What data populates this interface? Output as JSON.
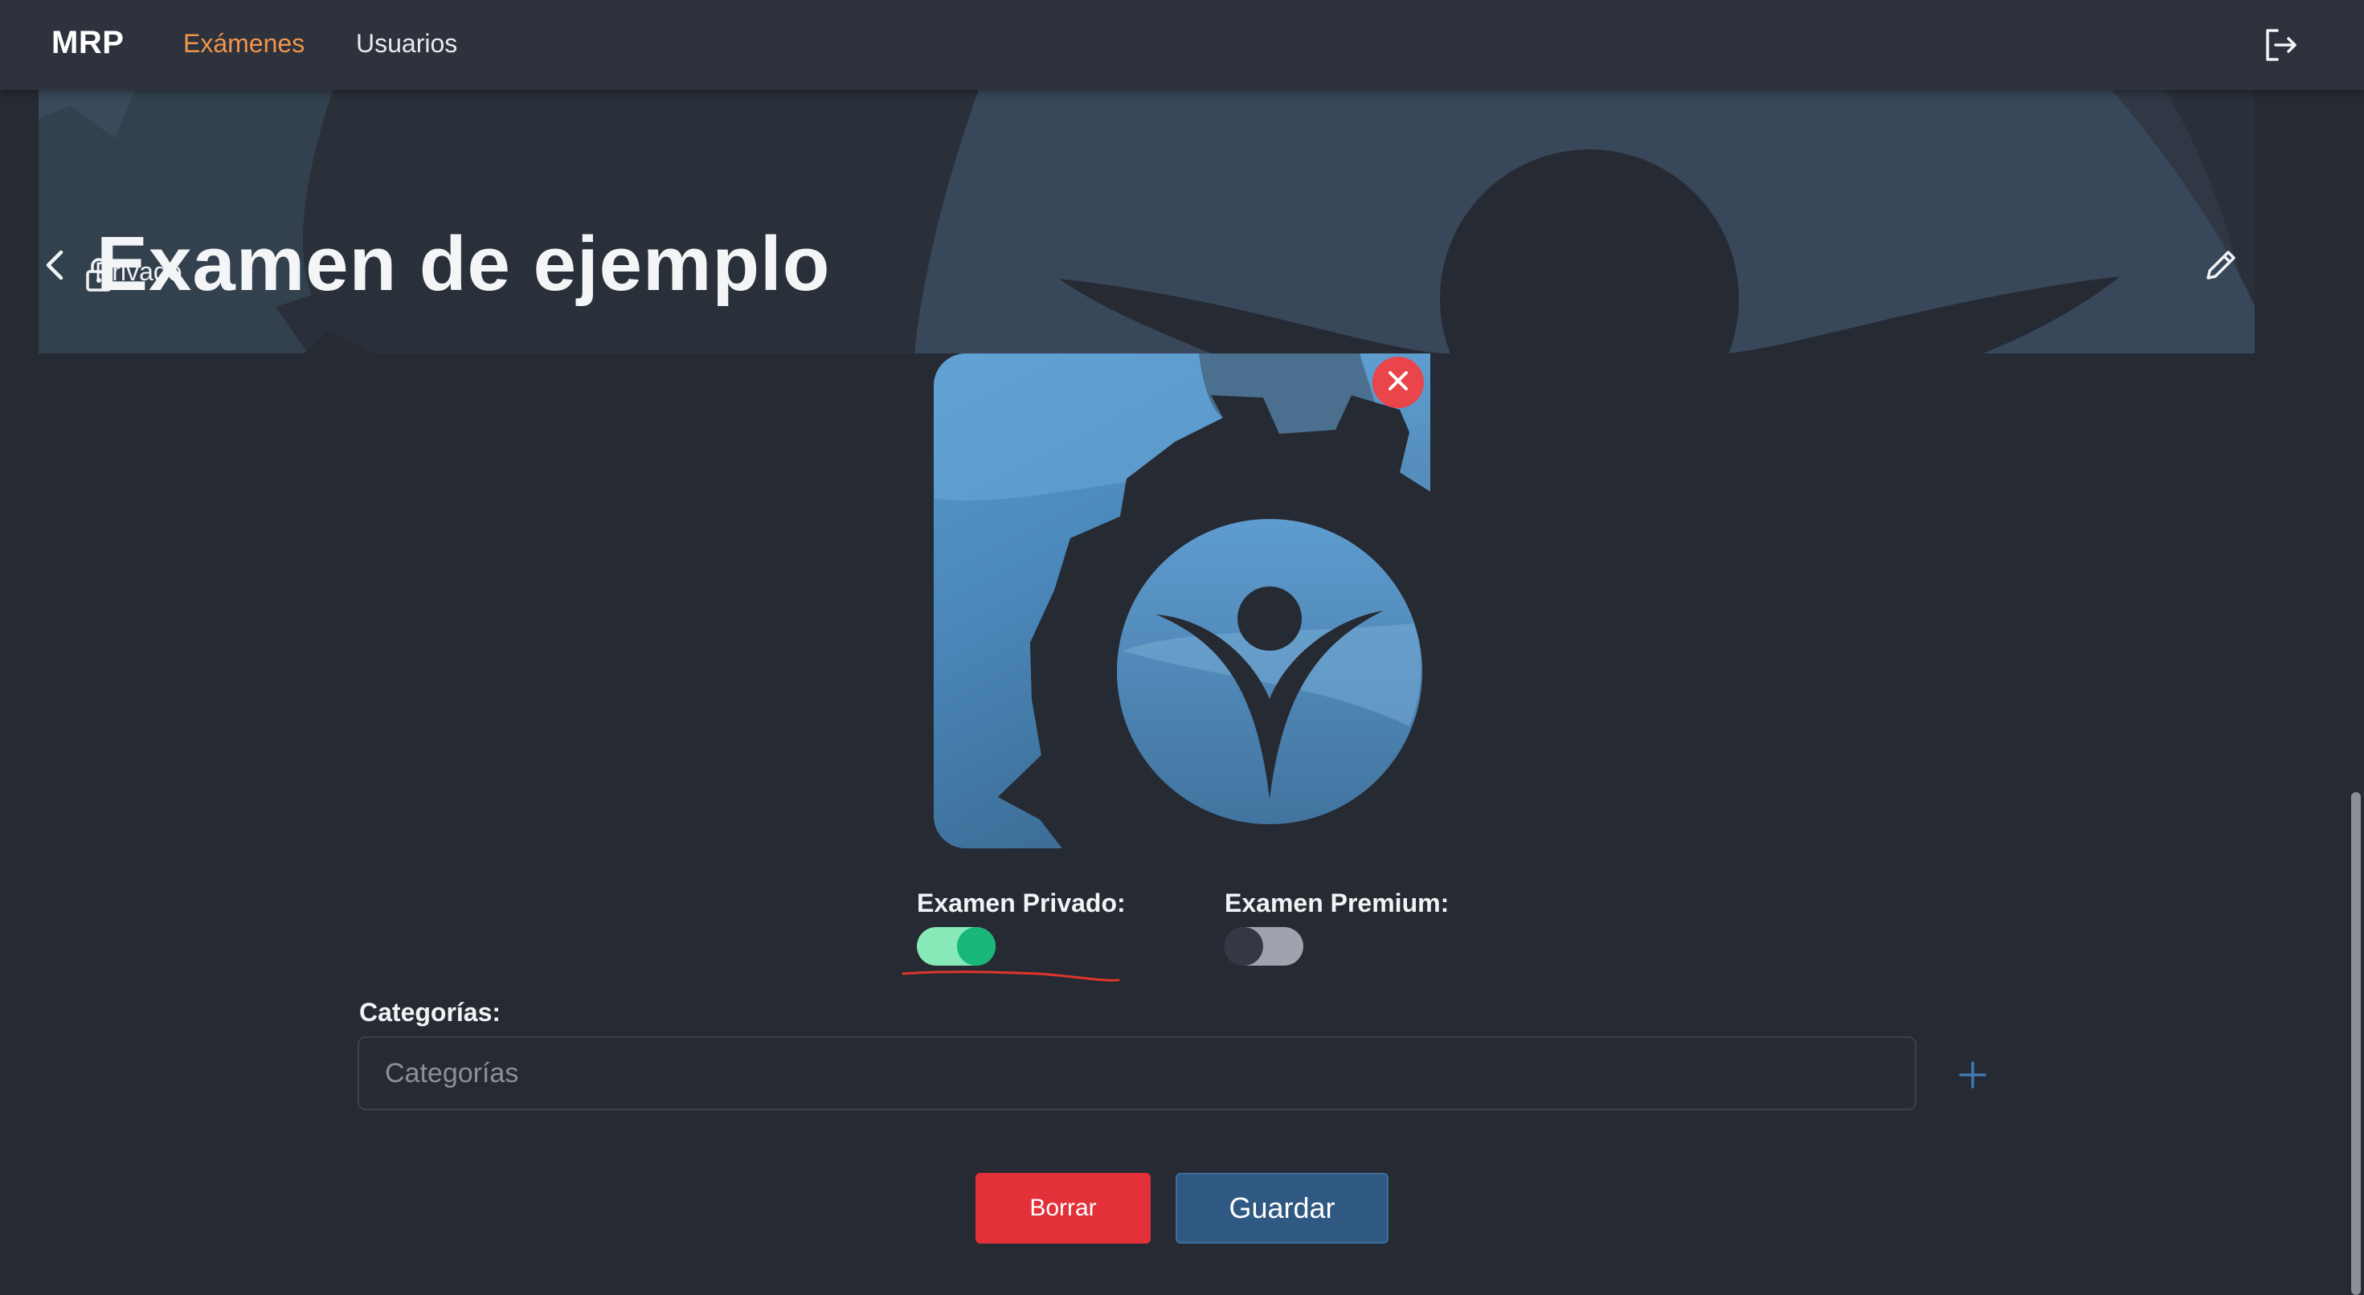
{
  "nav": {
    "brand": "MRP",
    "links": [
      {
        "label": "Exámenes",
        "active": true
      },
      {
        "label": "Usuarios",
        "active": false
      }
    ],
    "logout_icon": "logout-icon"
  },
  "header": {
    "privacy_icon": "lock-icon",
    "privacy_label": "Privado",
    "title": "Examen de ejemplo",
    "actions": [
      "edit-icon",
      "trash-icon"
    ]
  },
  "image": {
    "remove_icon": "close-icon"
  },
  "toggles": {
    "private": {
      "label": "Examen Privado:",
      "checked": true
    },
    "premium": {
      "label": "Examen Premium:",
      "checked": false
    }
  },
  "categories": {
    "label": "Categorías:",
    "placeholder": "Categorías",
    "value": "",
    "add_icon": "plus-icon"
  },
  "buttons": {
    "delete_label": "Borrar",
    "save_label": "Guardar"
  },
  "colors": {
    "accent": "#f0954a",
    "danger": "#e3313a",
    "primary": "#2f5982",
    "toggle_on": "#18b779",
    "background": "#262a33"
  }
}
